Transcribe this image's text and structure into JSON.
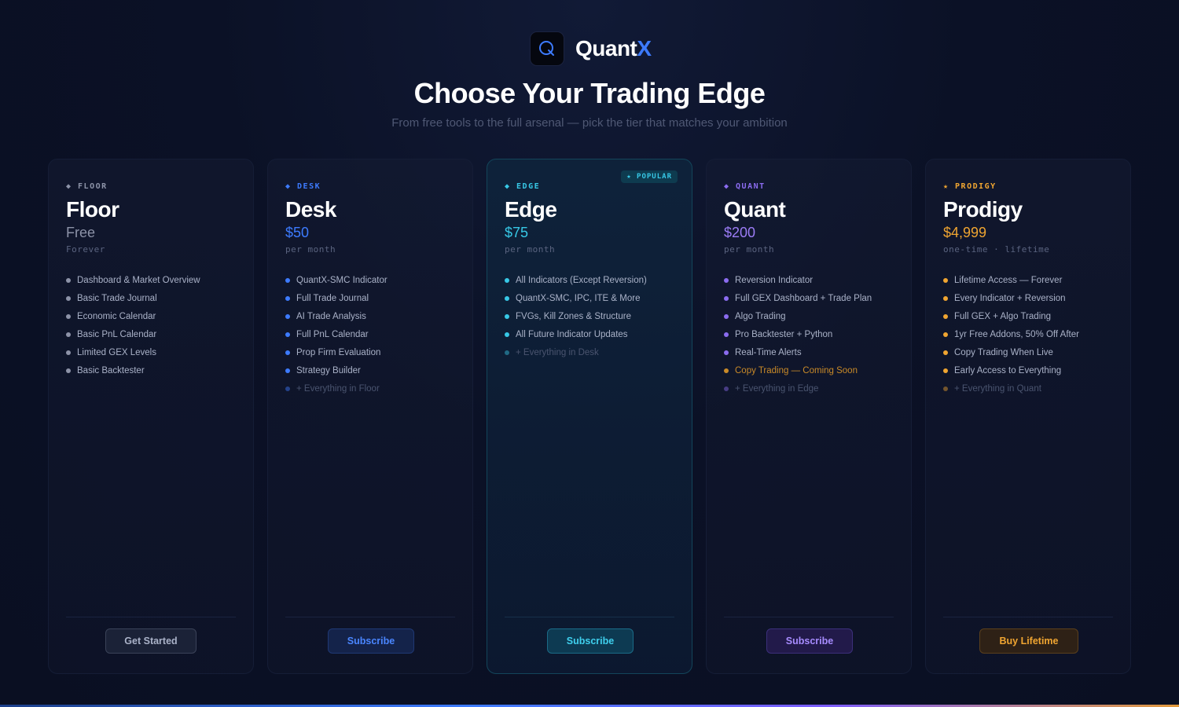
{
  "brand": {
    "name_main": "Quant",
    "name_accent": "X",
    "logo_letter": "Q"
  },
  "heading": {
    "title": "Choose Your Trading Edge",
    "subtitle": "From free tools to the full arsenal — pick the tier that matches your ambition"
  },
  "colors": {
    "floor": "#8d93a8",
    "desk": "#3d7bff",
    "edge": "#37c8e6",
    "quant": "#8b6cf0",
    "prodigy": "#f0a531",
    "coming_soon": "#c98a28"
  },
  "tiers": [
    {
      "tag": "◆ FLOOR",
      "name": "Floor",
      "price": "Free",
      "period": "Forever",
      "features": [
        "Dashboard & Market Overview",
        "Basic Trade Journal",
        "Economic Calendar",
        "Basic PnL Calendar",
        "Limited GEX Levels",
        "Basic Backtester"
      ],
      "button": "Get Started"
    },
    {
      "tag": "◆ DESK",
      "name": "Desk",
      "price": "$50",
      "period": "per month",
      "features": [
        "QuantX-SMC Indicator",
        "Full Trade Journal",
        "AI Trade Analysis",
        "Full PnL Calendar",
        "Prop Firm Evaluation",
        "Strategy Builder",
        "+ Everything in Floor"
      ],
      "button": "Subscribe"
    },
    {
      "tag": "◆ EDGE",
      "name": "Edge",
      "price": "$75",
      "period": "per month",
      "badge": "★ POPULAR",
      "features": [
        "All Indicators (Except Reversion)",
        "QuantX-SMC, IPC, ITE & More",
        "FVGs, Kill Zones & Structure",
        "All Future Indicator Updates",
        "+ Everything in Desk"
      ],
      "button": "Subscribe"
    },
    {
      "tag": "◆ QUANT",
      "name": "Quant",
      "price": "$200",
      "period": "per month",
      "features": [
        "Reversion Indicator",
        "Full GEX Dashboard + Trade Plan",
        "Algo Trading",
        "Pro Backtester + Python",
        "Real-Time Alerts",
        "Copy Trading — Coming Soon",
        "+ Everything in Edge"
      ],
      "button": "Subscribe"
    },
    {
      "tag": "★ PRODIGY",
      "name": "Prodigy",
      "price": "$4,999",
      "period": "one-time · lifetime",
      "features": [
        "Lifetime Access — Forever",
        "Every Indicator + Reversion",
        "Full GEX + Algo Trading",
        "1yr Free Addons, 50% Off After",
        "Copy Trading When Live",
        "Early Access to Everything",
        "+ Everything in Quant"
      ],
      "button": "Buy Lifetime"
    }
  ]
}
